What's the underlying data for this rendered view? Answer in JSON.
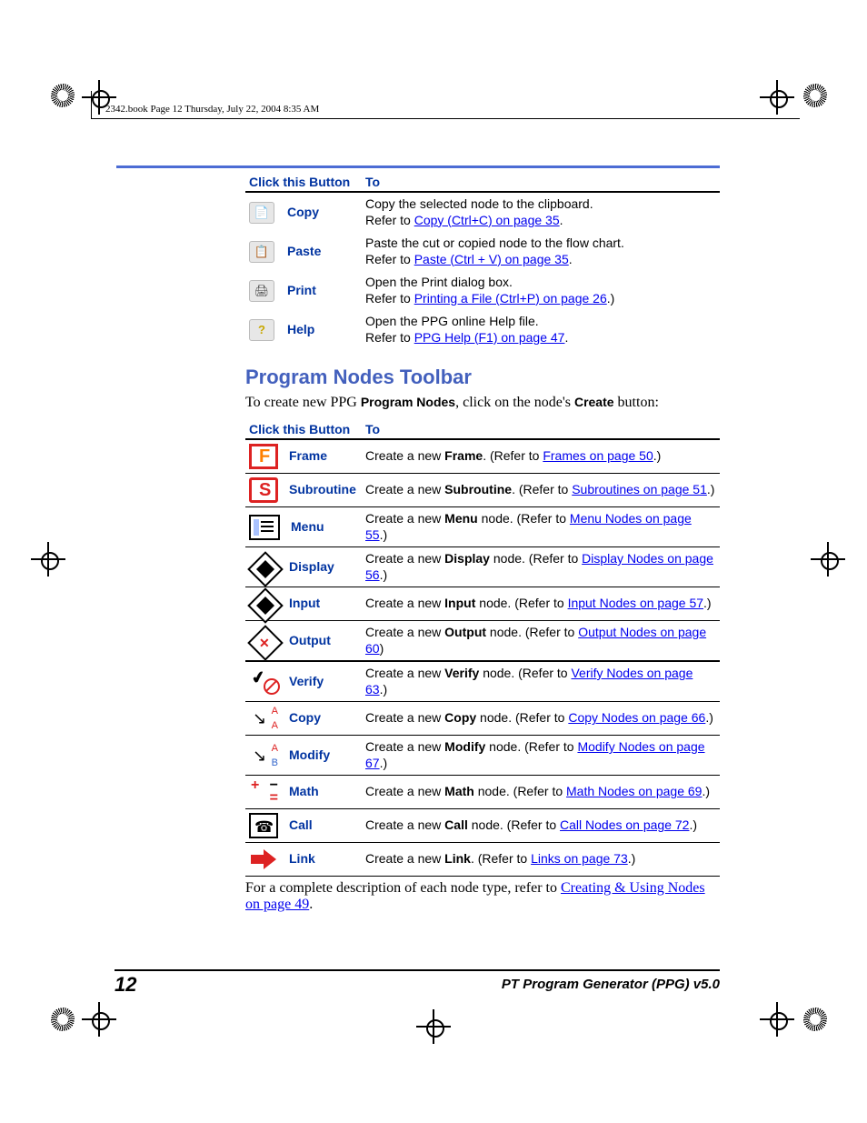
{
  "meta_header": "2342.book  Page 12  Thursday, July 22, 2004  8:35 AM",
  "table1": {
    "h1": "Click this Button",
    "h2": "To",
    "rows": [
      {
        "label": "Copy",
        "line1": "Copy the selected node to the clipboard.",
        "ref_pre": "Refer to ",
        "link": "Copy (Ctrl+C) on page 35",
        "post": "."
      },
      {
        "label": "Paste",
        "line1": "Paste the cut or copied node to the flow chart.",
        "ref_pre": "Refer to ",
        "link": "Paste (Ctrl + V) on page 35",
        "post": "."
      },
      {
        "label": "Print",
        "line1": "Open the Print dialog box.",
        "ref_pre": "Refer to ",
        "link": "Printing a File (Ctrl+P) on page 26",
        "post": ".)"
      },
      {
        "label": "Help",
        "line1": "Open the PPG online Help file.",
        "ref_pre": "Refer to ",
        "link": "PPG Help (F1) on page 47",
        "post": "."
      }
    ]
  },
  "section_title": "Program Nodes Toolbar",
  "section_intro_pre": "To create new PPG ",
  "section_intro_b1": "Program Nodes",
  "section_intro_mid": ", click on the node's ",
  "section_intro_b2": "Create",
  "section_intro_post": " button:",
  "table2": {
    "h1": "Click this Button",
    "h2": "To",
    "rows": [
      {
        "label": "Frame",
        "pre": "Create a new ",
        "bold": "Frame",
        "mid": ". (Refer to ",
        "link": "Frames on page 50",
        "post": ".)"
      },
      {
        "label": "Subroutine",
        "pre": "Create a new ",
        "bold": "Subroutine",
        "mid": ". (Refer to ",
        "link": "Subroutines on page 51",
        "post": ".)"
      },
      {
        "label": "Menu",
        "pre": "Create a new ",
        "bold": "Menu",
        "mid": " node. (Refer to ",
        "link": "Menu Nodes on page 55",
        "post": ".)"
      },
      {
        "label": "Display",
        "pre": "Create a new ",
        "bold": "Display",
        "mid": " node. (Refer to ",
        "link": "Display Nodes on page 56",
        "post": ".)"
      },
      {
        "label": "Input",
        "pre": "Create a new ",
        "bold": "Input",
        "mid": " node. (Refer to ",
        "link": "Input Nodes on page 57",
        "post": ".)"
      },
      {
        "label": "Output",
        "pre": "Create a new ",
        "bold": "Output",
        "mid": " node. (Refer to ",
        "link": "Output Nodes on page 60",
        "post": ")"
      },
      {
        "label": "Verify",
        "pre": "Create a new ",
        "bold": "Verify",
        "mid": " node. (Refer to ",
        "link": "Verify Nodes on page 63",
        "post": ".)"
      },
      {
        "label": "Copy",
        "pre": "Create a new ",
        "bold": "Copy",
        "mid": " node. (Refer to ",
        "link": "Copy Nodes on page 66",
        "post": ".)"
      },
      {
        "label": "Modify",
        "pre": "Create a new ",
        "bold": "Modify",
        "mid": " node. (Refer to ",
        "link": "Modify Nodes on page 67",
        "post": ".)"
      },
      {
        "label": "Math",
        "pre": "Create a new ",
        "bold": "Math",
        "mid": " node. (Refer to ",
        "link": "Math Nodes on page 69",
        "post": ".)"
      },
      {
        "label": "Call",
        "pre": "Create a new ",
        "bold": "Call",
        "mid": " node. (Refer to ",
        "link": "Call Nodes on page 72",
        "post": ".)"
      },
      {
        "label": "Link",
        "pre": "Create a new ",
        "bold": "Link",
        "mid": ". (Refer to ",
        "link": "Links on page 73",
        "post": ".)"
      }
    ]
  },
  "closing_pre": "For a complete description of each node type, refer to ",
  "closing_link": "Creating & Using Nodes on page 49",
  "closing_post": ".",
  "page_number": "12",
  "footer_title": "PT Program Generator (PPG)  v5.0"
}
